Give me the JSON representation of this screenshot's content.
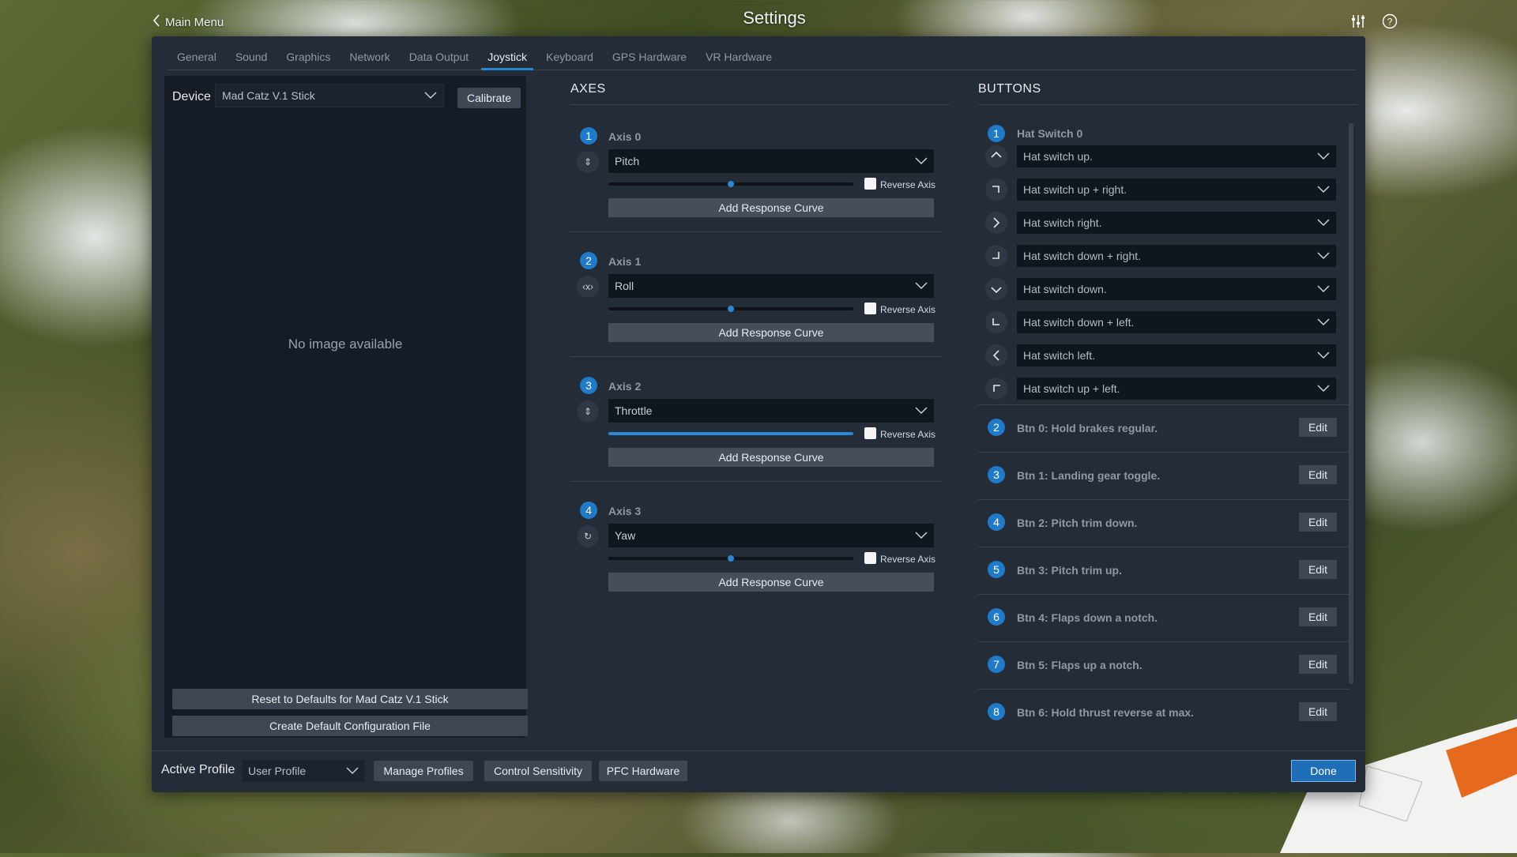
{
  "header": {
    "title": "Settings",
    "back_label": "Main Menu"
  },
  "tabs": [
    "General",
    "Sound",
    "Graphics",
    "Network",
    "Data Output",
    "Joystick",
    "Keyboard",
    "GPS Hardware",
    "VR Hardware"
  ],
  "active_tab": "Joystick",
  "device": {
    "label": "Device",
    "selected": "Mad Catz V.1 Stick",
    "calibrate_label": "Calibrate",
    "no_image_text": "No image available",
    "reset_label": "Reset to Defaults for Mad Catz V.1 Stick",
    "create_config_label": "Create Default Configuration File"
  },
  "axes": {
    "title": "AXES",
    "reverse_label": "Reverse Axis",
    "curve_label": "Add Response Curve",
    "items": [
      {
        "num": "1",
        "name": "Axis 0",
        "assignment": "Pitch",
        "level": 0.5,
        "reversed": false
      },
      {
        "num": "2",
        "name": "Axis 1",
        "assignment": "Roll",
        "level": 0.5,
        "reversed": false
      },
      {
        "num": "3",
        "name": "Axis 2",
        "assignment": "Throttle",
        "level": 1.0,
        "reversed": false
      },
      {
        "num": "4",
        "name": "Axis 3",
        "assignment": "Yaw",
        "level": 0.5,
        "reversed": false
      }
    ]
  },
  "buttons": {
    "title": "BUTTONS",
    "hat": {
      "num": "1",
      "name": "Hat Switch 0",
      "directions": [
        "Hat switch up.",
        "Hat switch up + right.",
        "Hat switch right.",
        "Hat switch down + right.",
        "Hat switch down.",
        "Hat switch down + left.",
        "Hat switch left.",
        "Hat switch up + left."
      ]
    },
    "edit_label": "Edit",
    "items": [
      {
        "num": "2",
        "label": "Btn 0: Hold brakes regular."
      },
      {
        "num": "3",
        "label": "Btn 1: Landing gear toggle."
      },
      {
        "num": "4",
        "label": "Btn 2: Pitch trim down."
      },
      {
        "num": "5",
        "label": "Btn 3: Pitch trim up."
      },
      {
        "num": "6",
        "label": "Btn 4: Flaps down a notch."
      },
      {
        "num": "7",
        "label": "Btn 5: Flaps up a notch."
      },
      {
        "num": "8",
        "label": "Btn 6: Hold thrust reverse at max."
      }
    ]
  },
  "footer": {
    "active_profile_label": "Active Profile",
    "profile_selected": "User Profile",
    "manage_profiles_label": "Manage Profiles",
    "control_sensitivity_label": "Control Sensitivity",
    "pfc_hardware_label": "PFC Hardware",
    "done_label": "Done"
  },
  "colors": {
    "accent": "#1f7ac8",
    "panel": "#242c37",
    "inner_panel": "#151c25"
  }
}
